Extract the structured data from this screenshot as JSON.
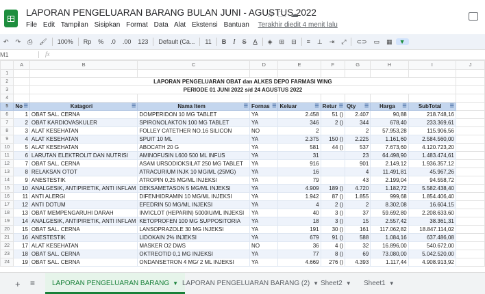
{
  "doc": {
    "title": "LAPORAN PENGELUARAN BARANG BULAN JUNI - AGUSTUS 2022",
    "menu": [
      "File",
      "Edit",
      "Tampilan",
      "Sisipkan",
      "Format",
      "Data",
      "Alat",
      "Ekstensi",
      "Bantuan"
    ],
    "last_edit": "Terakhir diedit 4 menit lalu"
  },
  "toolbar": {
    "zoom": "100%",
    "currency": "Rp",
    "percent": "%",
    "dec_less": ".0",
    "dec_more": ".00",
    "format_more": "123",
    "font": "Default (Ca...",
    "size": "11",
    "bold": "B",
    "italic": "I",
    "strike": "S",
    "text_color": "A"
  },
  "formula_bar": {
    "cell_ref": "M1",
    "fx": "fx"
  },
  "columns": [
    "A",
    "B",
    "C",
    "D",
    "E",
    "F",
    "G",
    "H",
    "I",
    "J"
  ],
  "report": {
    "title": "LAPORAN PENGELUARAN OBAT dan ALKES DEPO FARMASI WING",
    "period": "PERIODE 01 JUNI 2022 s/d 24 AGUSTUS 2022"
  },
  "table": {
    "headers": [
      "No",
      "Katagori",
      "Nama Item",
      "Fornas",
      "Keluar",
      "Retur",
      "Qty",
      "Harga",
      "SubTotal"
    ],
    "rows": [
      [
        "1",
        "OBAT SAL. CERNA",
        "DOMPERIDON 10 MG TABLET",
        "YA",
        "2.458",
        "51 ()",
        "2.407",
        "90,88",
        "218.748,16"
      ],
      [
        "2",
        "OBAT KARDIOVASKULER",
        "SPIRONOLAKTON 100 MG TABLET",
        "YA",
        "346",
        "2 ()",
        "344",
        "678,40",
        "233.369,61"
      ],
      [
        "3",
        "ALAT KESEHATAN",
        "FOLLEY CATETHER NO.16 SILICON",
        "NO",
        "2",
        "",
        "2",
        "57.953,28",
        "115.906,56"
      ],
      [
        "4",
        "ALAT KESEHATAN",
        "SPUIT 10 ML",
        "YA",
        "2.375",
        "150 ()",
        "2.225",
        "1.161,60",
        "2.584.560,00"
      ],
      [
        "5",
        "ALAT KESEHATAN",
        "ABOCATH 20 G",
        "YA",
        "581",
        "44 ()",
        "537",
        "7.673,60",
        "4.120.723,20"
      ],
      [
        "6",
        "LARUTAN ELEKTROLIT DAN NUTRISI",
        "AMINOFUSIN L600 500 ML INFUS",
        "YA",
        "31",
        "",
        "23",
        "64.498,90",
        "1.483.474,61"
      ],
      [
        "7",
        "OBAT SAL. CERNA",
        "ASAM URSODIOKSILAT 250 MG TABLET",
        "YA",
        "916",
        "",
        "901",
        "2.149,12",
        "1.936.357,12"
      ],
      [
        "8",
        "RELAKSAN OTOT",
        "ATRACURIUM INJK 10 MG/ML (25MG)",
        "YA",
        "16",
        "",
        "4",
        "11.491,81",
        "45.967,26"
      ],
      [
        "9",
        "ANESTESTIK",
        "ATROPIN  0,25 MG/ML INJEKSI",
        "YA",
        "79",
        "",
        "43",
        "2.199,04",
        "94.558,72"
      ],
      [
        "10",
        "ANALGESIK, ANTIPIRETIK, ANTI INFLAM",
        "DEKSAMETASON  5 MG/ML INJEKSI",
        "YA",
        "4.909",
        "189 ()",
        "4.720",
        "1.182,72",
        "5.582.438,40"
      ],
      [
        "11",
        "ANTI ALERGI",
        "DIFENHIDRAMIN 10 MG/ML INJEKSI",
        "YA",
        "1.942",
        "87 ()",
        "1.855",
        "999,68",
        "1.854.406,40"
      ],
      [
        "12",
        "ANTI DOTUM",
        "EFEDRIN 50 MG/ML INJEKSI",
        "YA",
        "4",
        "2 ()",
        "2",
        "8.302,08",
        "16.604,15"
      ],
      [
        "13",
        "OBAT MEMPENGARUHI DARAH",
        "INVICLOT (HEPARIN) 5000IU/ML INJEKSI",
        "YA",
        "40",
        "3 ()",
        "37",
        "59.692,80",
        "2.208.633,60"
      ],
      [
        "14",
        "ANALGESIK, ANTIPIRETIK, ANTI INFLAM",
        "KETOPROFEN 100 MG SUPPOSITORIA",
        "YA",
        "18",
        "3 ()",
        "15",
        "2.557,42",
        "38.361,31"
      ],
      [
        "15",
        "OBAT SAL. CERNA",
        "LANSOPRAZOLE 30 MG INJEKSI",
        "YA",
        "191",
        "30 ()",
        "161",
        "117.062,82",
        "18.847.114,02"
      ],
      [
        "16",
        "ANESTESTIK",
        "LIDOKAIN 2% INJEKSI",
        "YA",
        "679",
        "91 ()",
        "588",
        "1.084,16",
        "637.486,08"
      ],
      [
        "17",
        "ALAT KESEHATAN",
        "MASKER O2 DWS",
        "NO",
        "36",
        "4 ()",
        "32",
        "16.896,00",
        "540.672,00"
      ],
      [
        "18",
        "OBAT SAL. CERNA",
        "OKTREOTID 0,1 MG INJEKSI",
        "YA",
        "77",
        "8 ()",
        "69",
        "73.080,00",
        "5.042.520,00"
      ],
      [
        "19",
        "OBAT SAL. CERNA",
        "ONDANSETRON 4 MG/ 2 ML INJEKSI",
        "YA",
        "4.669",
        "276 ()",
        "4.393",
        "1.117,44",
        "4.908.913,92"
      ]
    ]
  },
  "sheets": [
    {
      "label": "LAPORAN PENGELUARAN BARANG",
      "active": true
    },
    {
      "label": "LAPORAN PENGELUARAN BARANG (2)",
      "active": false
    },
    {
      "label": "Sheet2",
      "active": false
    },
    {
      "label": "Sheet1",
      "active": false
    }
  ],
  "colors": {
    "accent": "#188038",
    "header_fill": "#c4d6ee",
    "band_fill": "#eef3fb"
  }
}
